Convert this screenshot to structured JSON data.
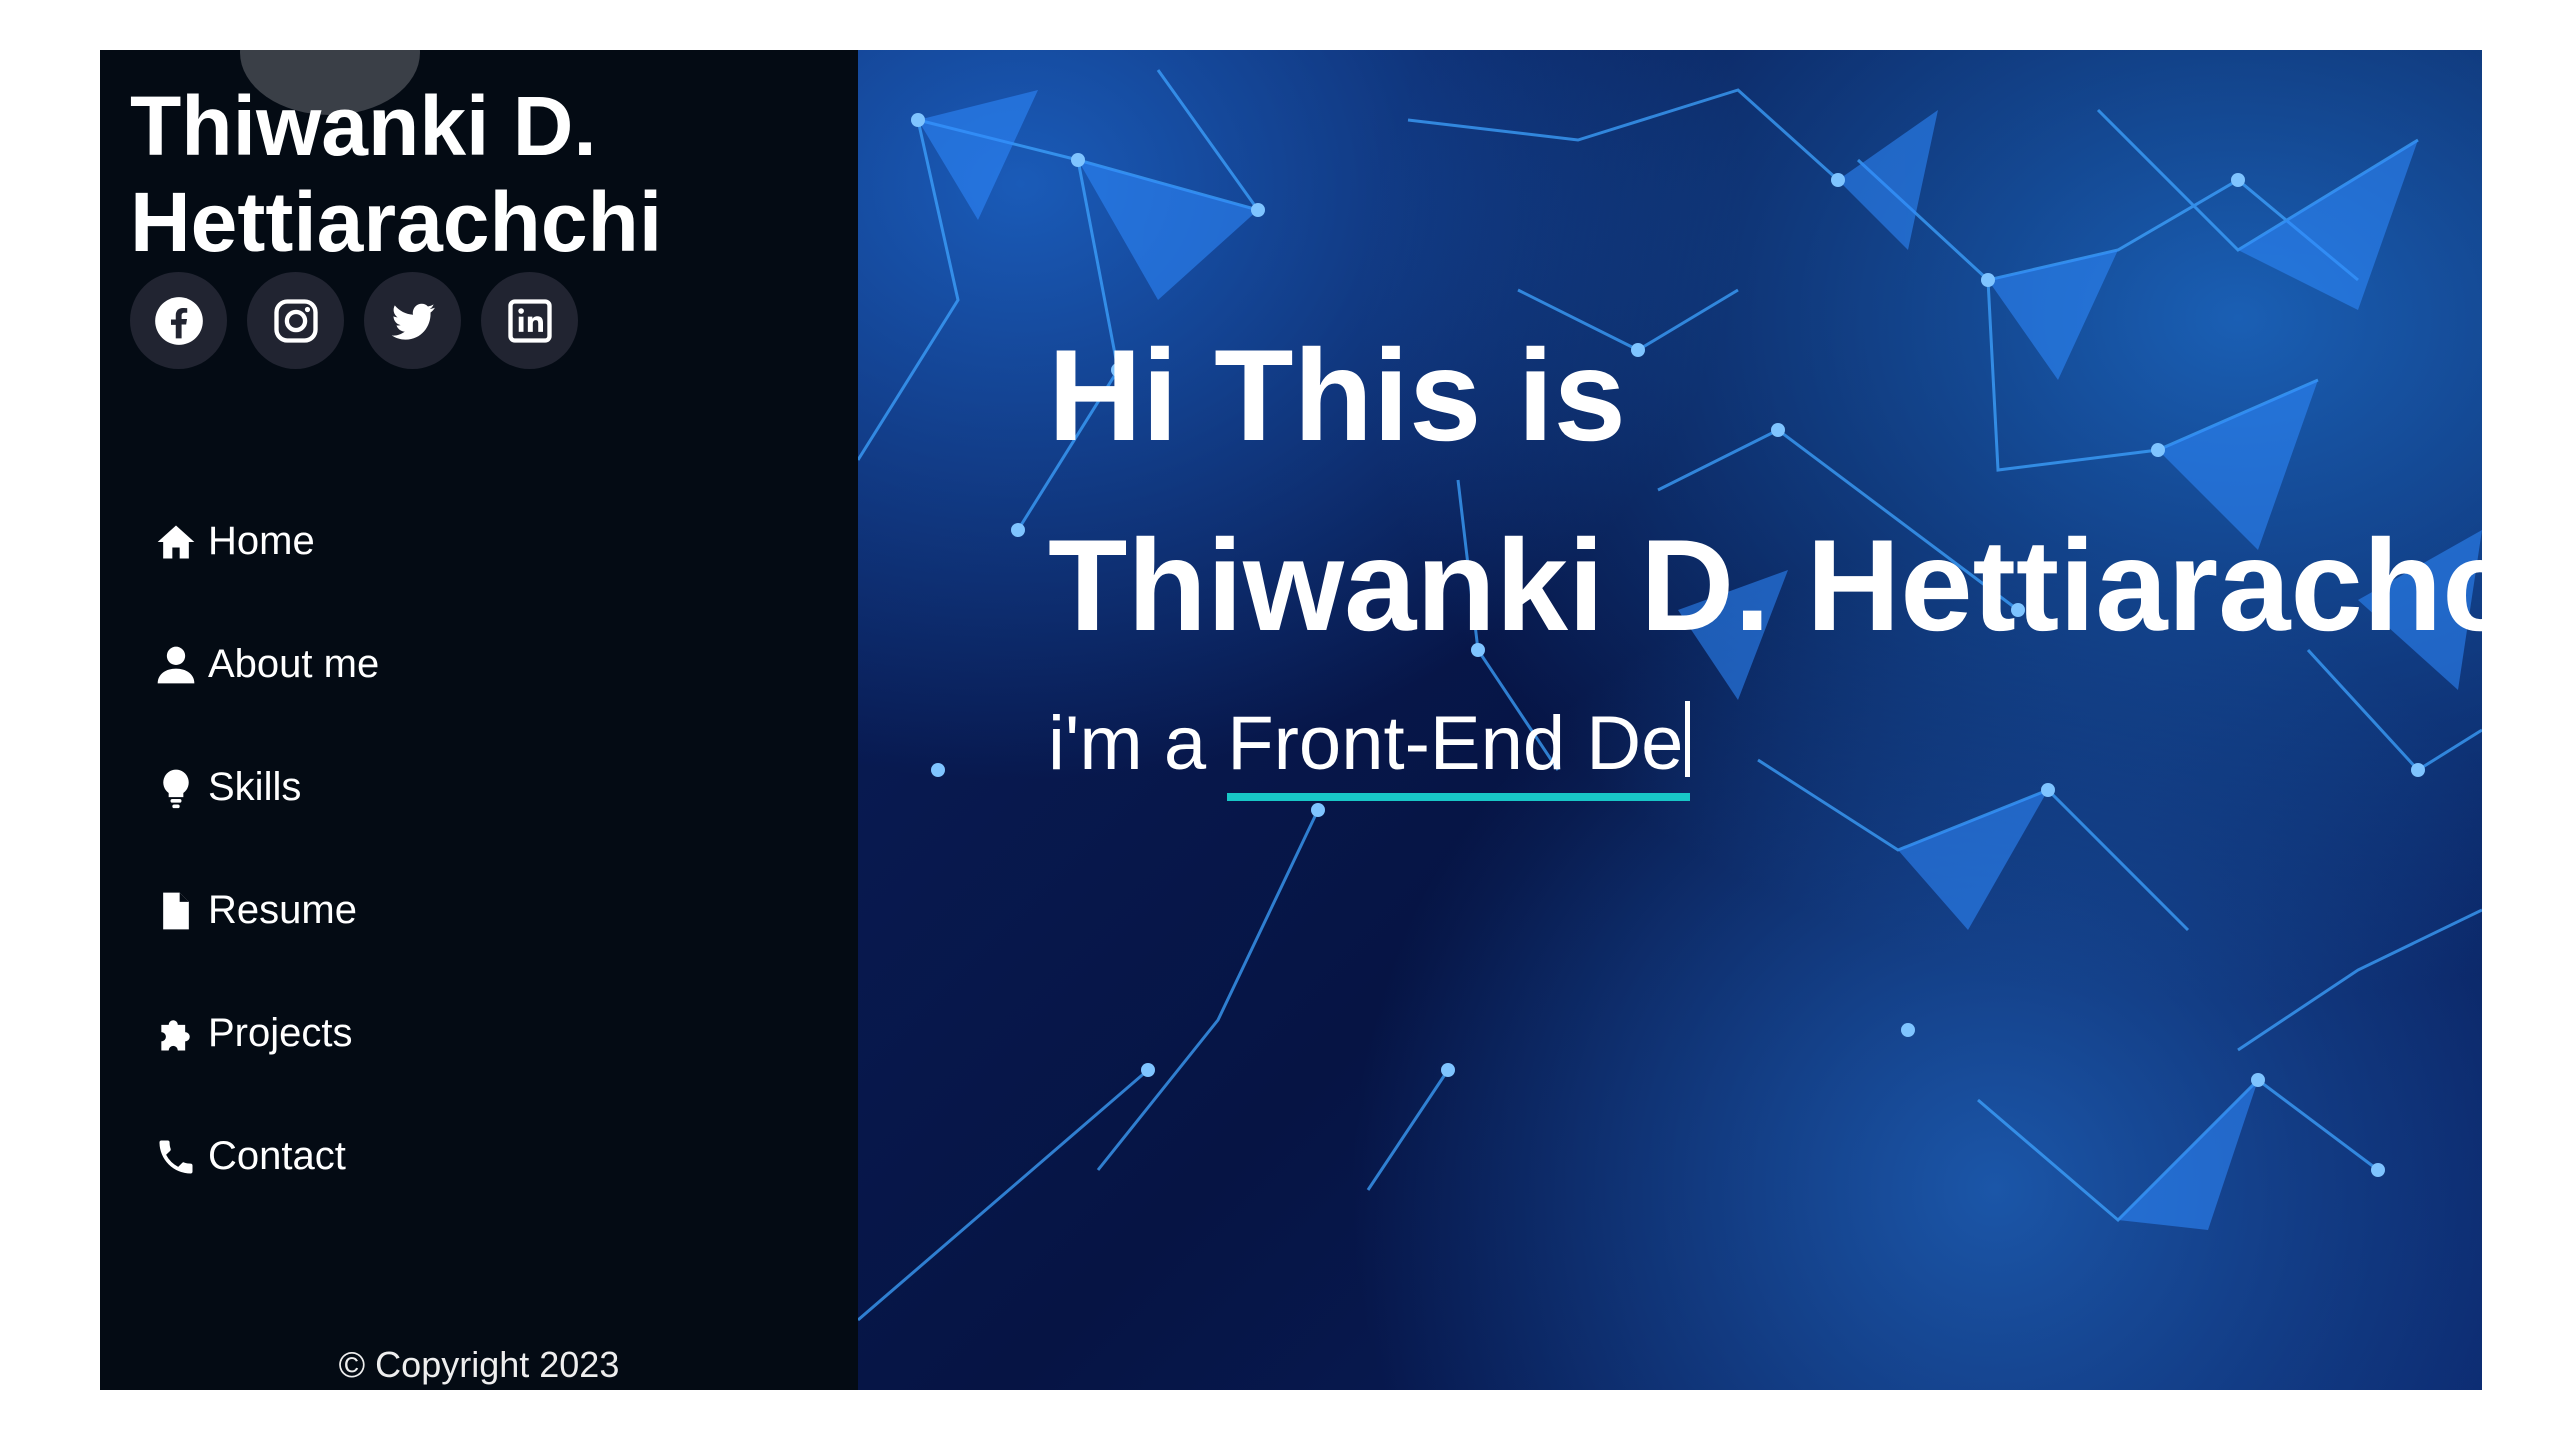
{
  "sidebar": {
    "name_line1": "Thiwanki D.",
    "name_line2": "Hettiarachchi",
    "social": [
      {
        "icon": "facebook-icon"
      },
      {
        "icon": "instagram-icon"
      },
      {
        "icon": "twitter-icon"
      },
      {
        "icon": "linkedin-icon"
      }
    ],
    "nav": [
      {
        "label": "Home",
        "icon": "home-icon"
      },
      {
        "label": "About me",
        "icon": "user-icon"
      },
      {
        "label": "Skills",
        "icon": "lightbulb-icon"
      },
      {
        "label": "Resume",
        "icon": "file-icon"
      },
      {
        "label": "Projects",
        "icon": "puzzle-icon"
      },
      {
        "label": "Contact",
        "icon": "phone-icon"
      }
    ],
    "copyright": "© Copyright 2023"
  },
  "hero": {
    "line1": "Hi This is",
    "line2": "Thiwanki D. Hettiarachchi",
    "subtitle_prefix": "i'm a ",
    "typed_text": "Front-End De"
  },
  "colors": {
    "sidebar_bg": "#040b14",
    "social_bg": "#212431",
    "typed_underline": "#18c7c7",
    "hero_bg": "#061444"
  }
}
